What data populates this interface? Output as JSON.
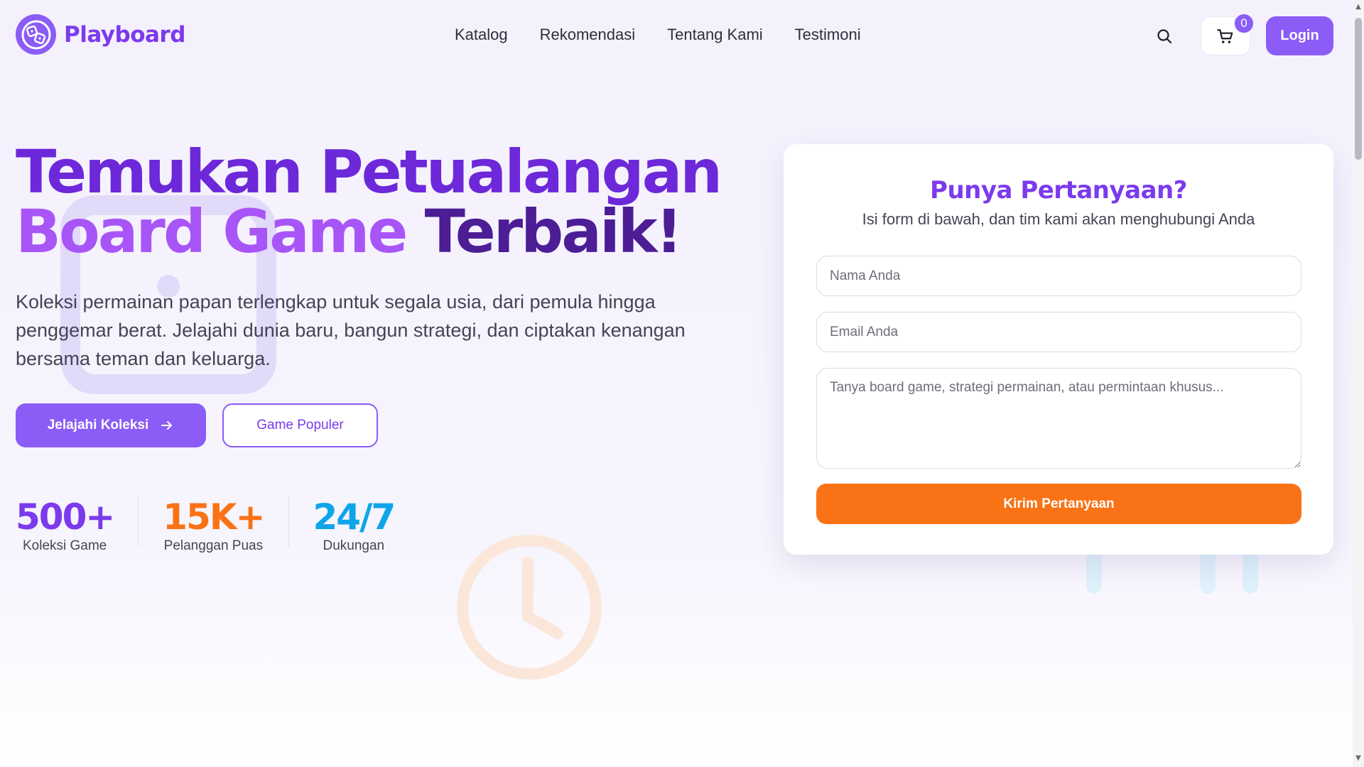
{
  "brand": {
    "name": "Playboard",
    "logo_icon": "gamepad-dice-logo-icon"
  },
  "nav": {
    "links": [
      "Katalog",
      "Rekomendasi",
      "Tentang Kami",
      "Testimoni"
    ],
    "search_icon": "search-icon",
    "cart_icon": "cart-icon",
    "cart_count": "0",
    "login_label": "Login"
  },
  "hero": {
    "title_line1": "Temukan Petualangan",
    "title_line2_highlight": "Board Game",
    "title_line2_rest": "Terbaik!",
    "description": "Koleksi permainan papan terlengkap untuk segala usia, dari pemula hingga penggemar berat. Jelajahi dunia baru, bangun strategi, dan ciptakan kenangan bersama teman dan keluarga.",
    "primary_button": "Jelajahi Koleksi",
    "secondary_button": "Game Populer",
    "stats": [
      {
        "value": "500+",
        "label": "Koleksi Game",
        "color": "#7c3aed"
      },
      {
        "value": "15K+",
        "label": "Pelanggan Puas",
        "color": "#f97316"
      },
      {
        "value": "24/7",
        "label": "Dukungan",
        "color": "#0ea5e9"
      }
    ]
  },
  "contact": {
    "title": "Punya Pertanyaan?",
    "subtitle": "Isi form di bawah, dan tim kami akan menghubungi Anda",
    "name_placeholder": "Nama Anda",
    "email_placeholder": "Email Anda",
    "message_placeholder": "Tanya board game, strategi permainan, atau permintaan khusus...",
    "submit_label": "Kirim Pertanyaan"
  },
  "colors": {
    "primary": "#8b5cf6",
    "primary_dark": "#7c3aed",
    "accent_orange": "#f97316",
    "accent_blue": "#0ea5e9"
  }
}
